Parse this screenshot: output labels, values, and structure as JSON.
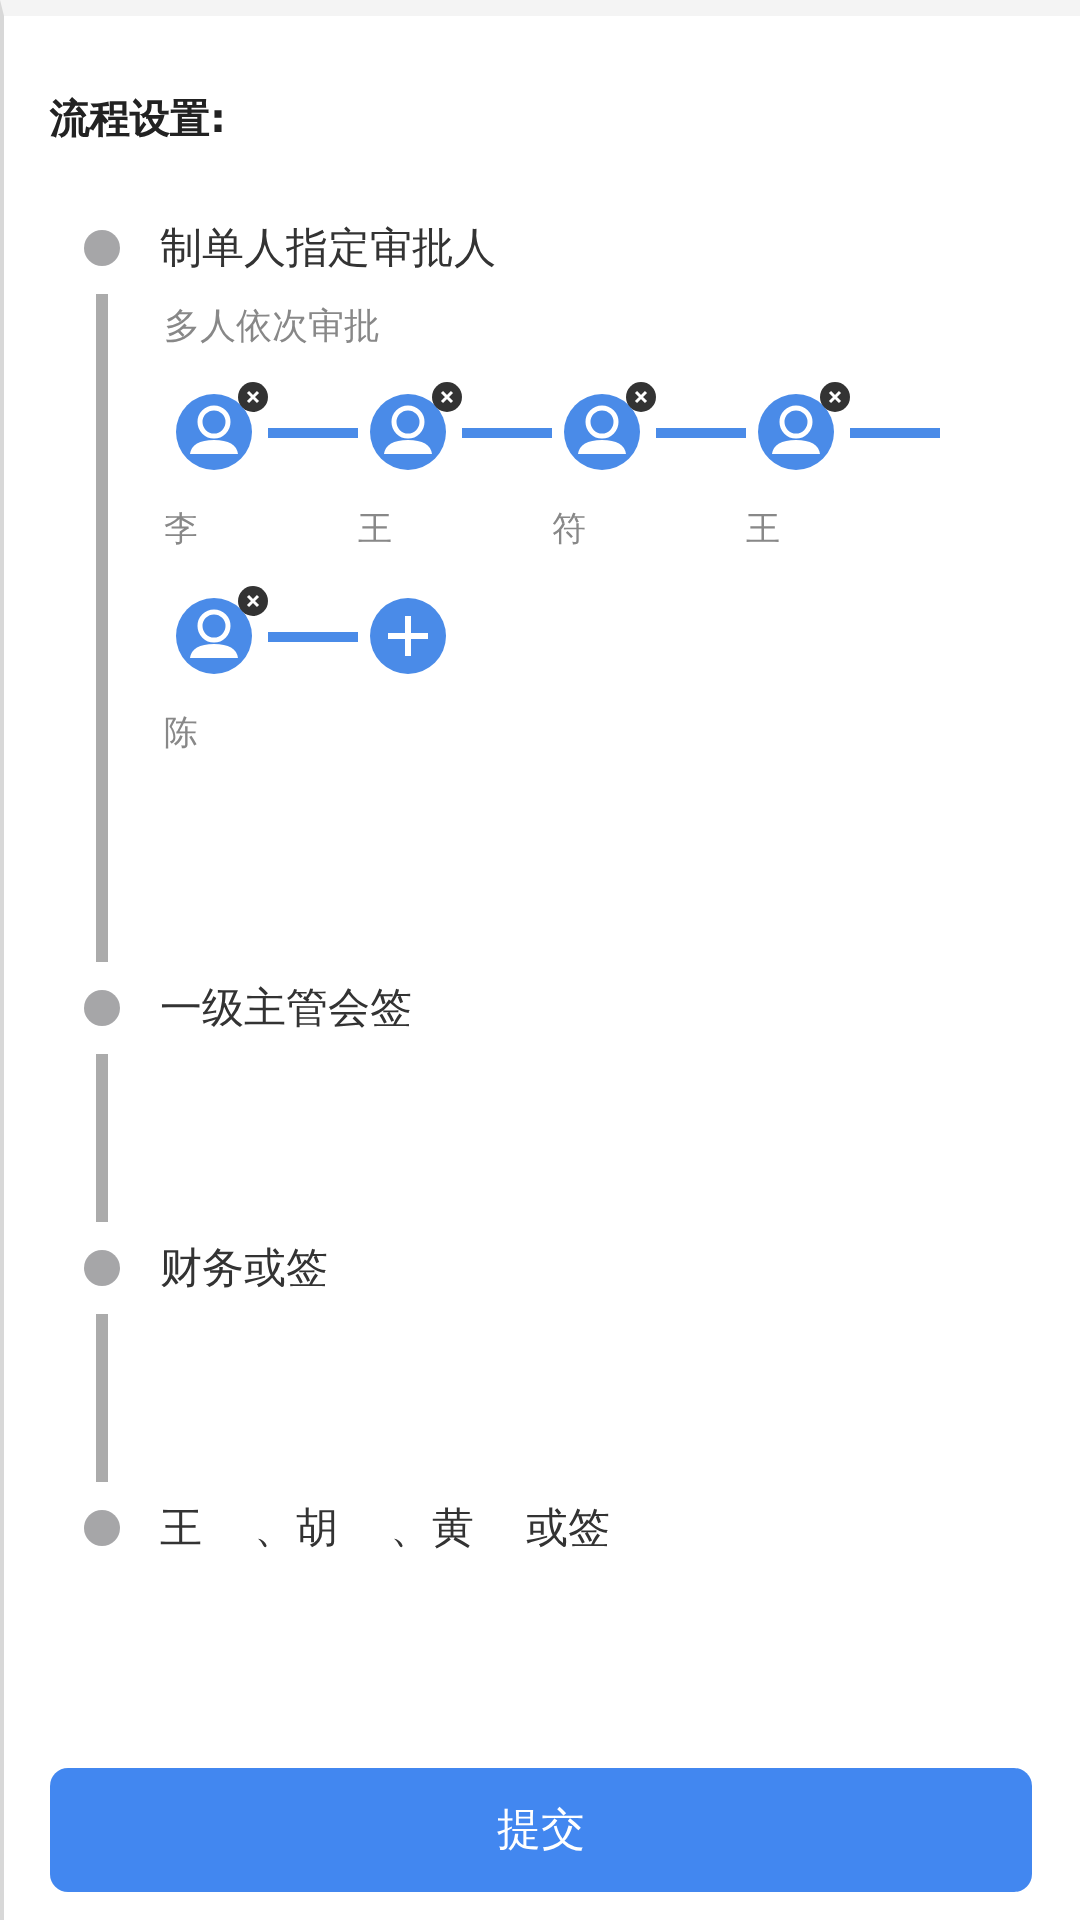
{
  "title": "流程设置:",
  "steps": [
    {
      "title_parts": [
        "制单人指定审批人"
      ],
      "mode": "多人依次审批",
      "approvers": [
        {
          "kind": "person",
          "name": "李",
          "removable": true
        },
        {
          "kind": "person",
          "name": "王",
          "removable": true
        },
        {
          "kind": "person",
          "name": "符",
          "removable": true
        },
        {
          "kind": "person",
          "name": "王",
          "removable": true
        },
        {
          "kind": "person",
          "name": "陈",
          "removable": true
        },
        {
          "kind": "add"
        }
      ]
    },
    {
      "title_parts": [
        "一级主管会签"
      ]
    },
    {
      "title_parts": [
        "财务或签"
      ]
    },
    {
      "title_parts": [
        "王",
        "、胡",
        "、黄",
        "或签"
      ]
    }
  ],
  "submit": "提交"
}
